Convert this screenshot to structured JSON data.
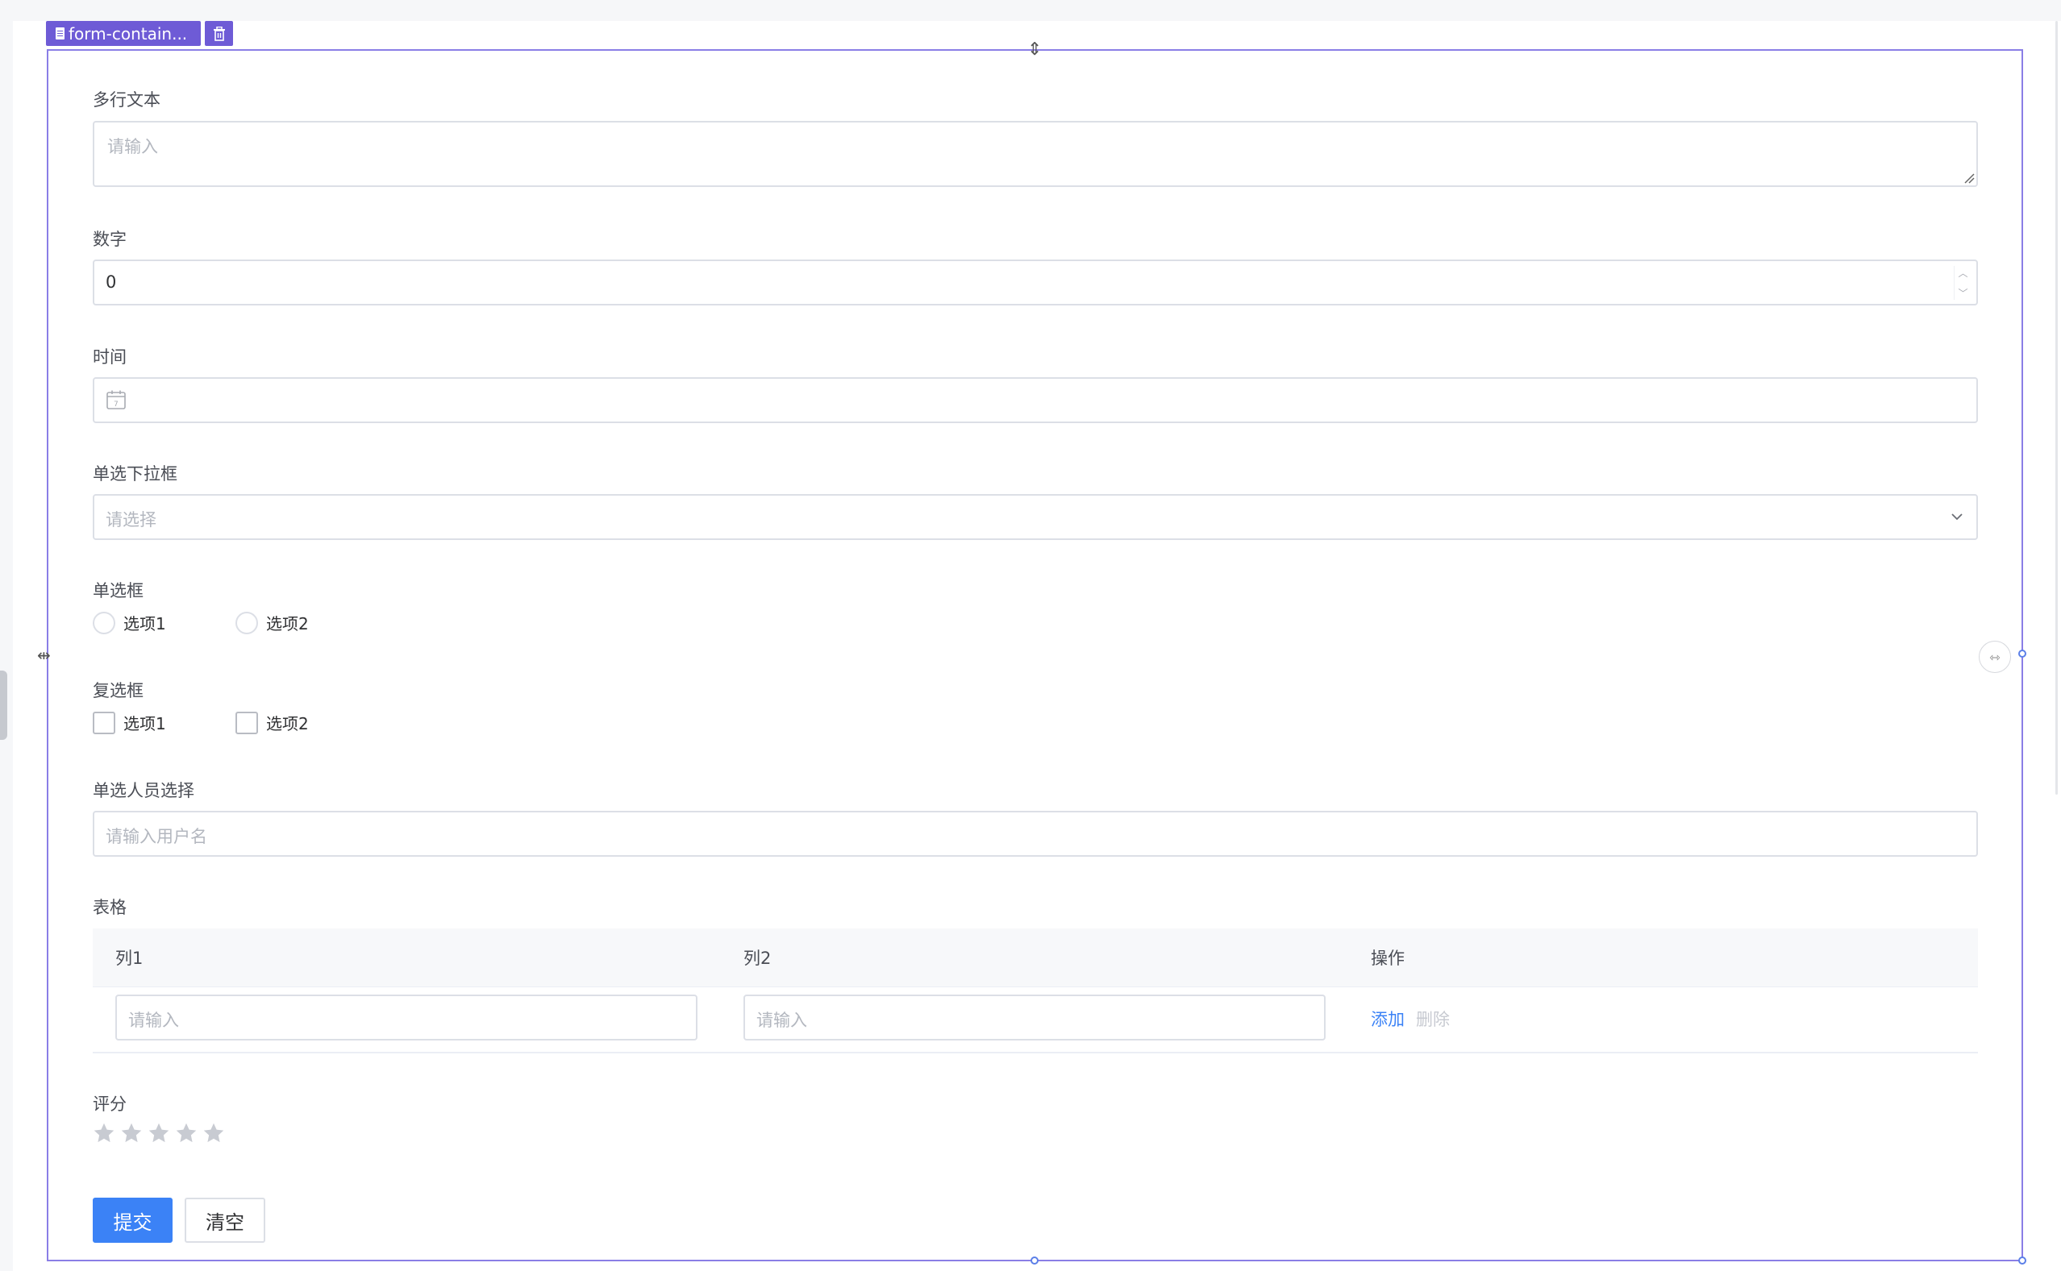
{
  "component": {
    "tag_label": "form-contain...",
    "delete_icon": "trash-icon"
  },
  "fields": {
    "textarea": {
      "label": "多行文本",
      "placeholder": "请输入"
    },
    "number": {
      "label": "数字",
      "value": "0"
    },
    "time": {
      "label": "时间",
      "icon": "calendar-icon"
    },
    "select": {
      "label": "单选下拉框",
      "placeholder": "请选择"
    },
    "radio": {
      "label": "单选框",
      "options": [
        "选项1",
        "选项2"
      ]
    },
    "checkbox": {
      "label": "复选框",
      "options": [
        "选项1",
        "选项2"
      ]
    },
    "user": {
      "label": "单选人员选择",
      "placeholder": "请输入用户名"
    },
    "table": {
      "label": "表格",
      "columns": [
        "列1",
        "列2",
        "操作"
      ],
      "row": {
        "col1_placeholder": "请输入",
        "col2_placeholder": "请输入",
        "add": "添加",
        "delete": "删除"
      }
    },
    "rating": {
      "label": "评分",
      "max": 5,
      "value": 0
    }
  },
  "actions": {
    "submit": "提交",
    "clear": "清空"
  },
  "colors": {
    "accent": "#3b82f6",
    "selection": "#6e5bd6",
    "star_empty": "#c8cbd2"
  }
}
